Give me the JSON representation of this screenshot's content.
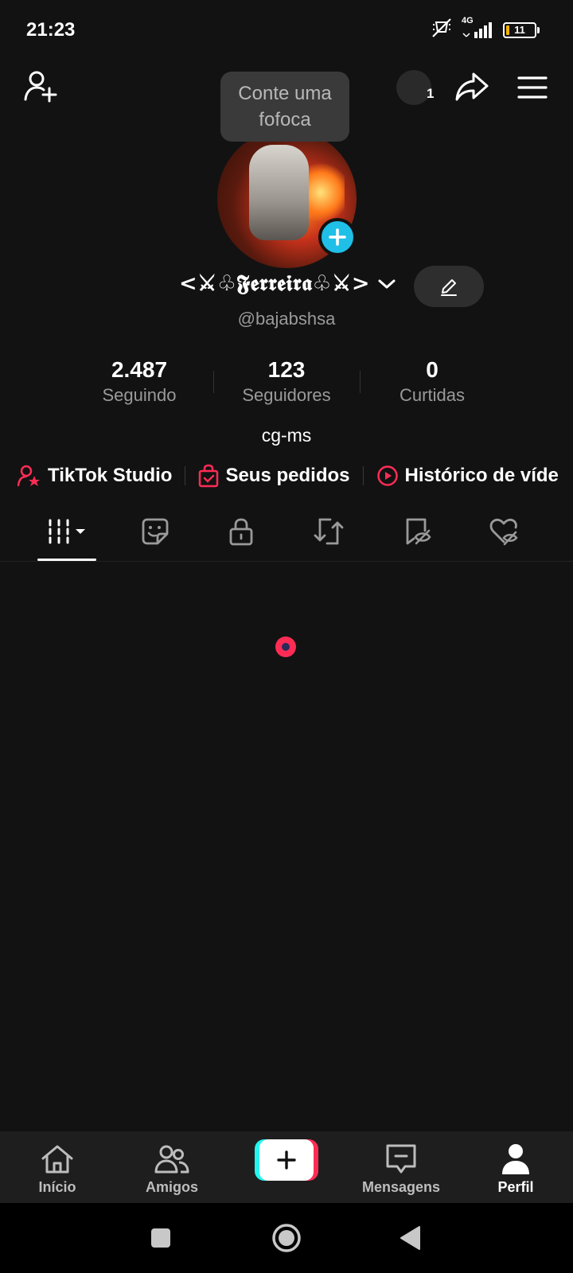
{
  "status_bar": {
    "time": "21:23",
    "network": "4G",
    "battery": "11"
  },
  "header": {
    "tooltip": "Conte uma fofoca",
    "notification_count": "1"
  },
  "profile": {
    "display_name": "<⚔♧𝕱𝖊𝖗𝖗𝖊𝖎𝖗𝖆♧⚔>",
    "handle": "@bajabshsa",
    "bio": "cg-ms",
    "stats": [
      {
        "value": "2.487",
        "label": "Seguindo"
      },
      {
        "value": "123",
        "label": "Seguidores"
      },
      {
        "value": "0",
        "label": "Curtidas"
      }
    ]
  },
  "quick_links": [
    {
      "label": "TikTok Studio",
      "icon": "person-star-icon"
    },
    {
      "label": "Seus pedidos",
      "icon": "shopping-bag-icon"
    },
    {
      "label": "Histórico de víde",
      "icon": "play-circle-icon"
    }
  ],
  "tabs": [
    {
      "name": "videos-grid",
      "icon": "grid-icon"
    },
    {
      "name": "stickers",
      "icon": "sticker-icon"
    },
    {
      "name": "private",
      "icon": "lock-icon"
    },
    {
      "name": "reposts",
      "icon": "repost-icon"
    },
    {
      "name": "favorites",
      "icon": "bookmark-hidden-icon"
    },
    {
      "name": "liked",
      "icon": "heart-hidden-icon"
    }
  ],
  "bottom_nav": {
    "home": "Início",
    "friends": "Amigos",
    "messages": "Mensagens",
    "profile": "Perfil"
  },
  "colors": {
    "background": "#121212",
    "accent_red": "#fe2c55",
    "accent_cyan": "#25f4ee",
    "avatar_add": "#20bfe8"
  }
}
